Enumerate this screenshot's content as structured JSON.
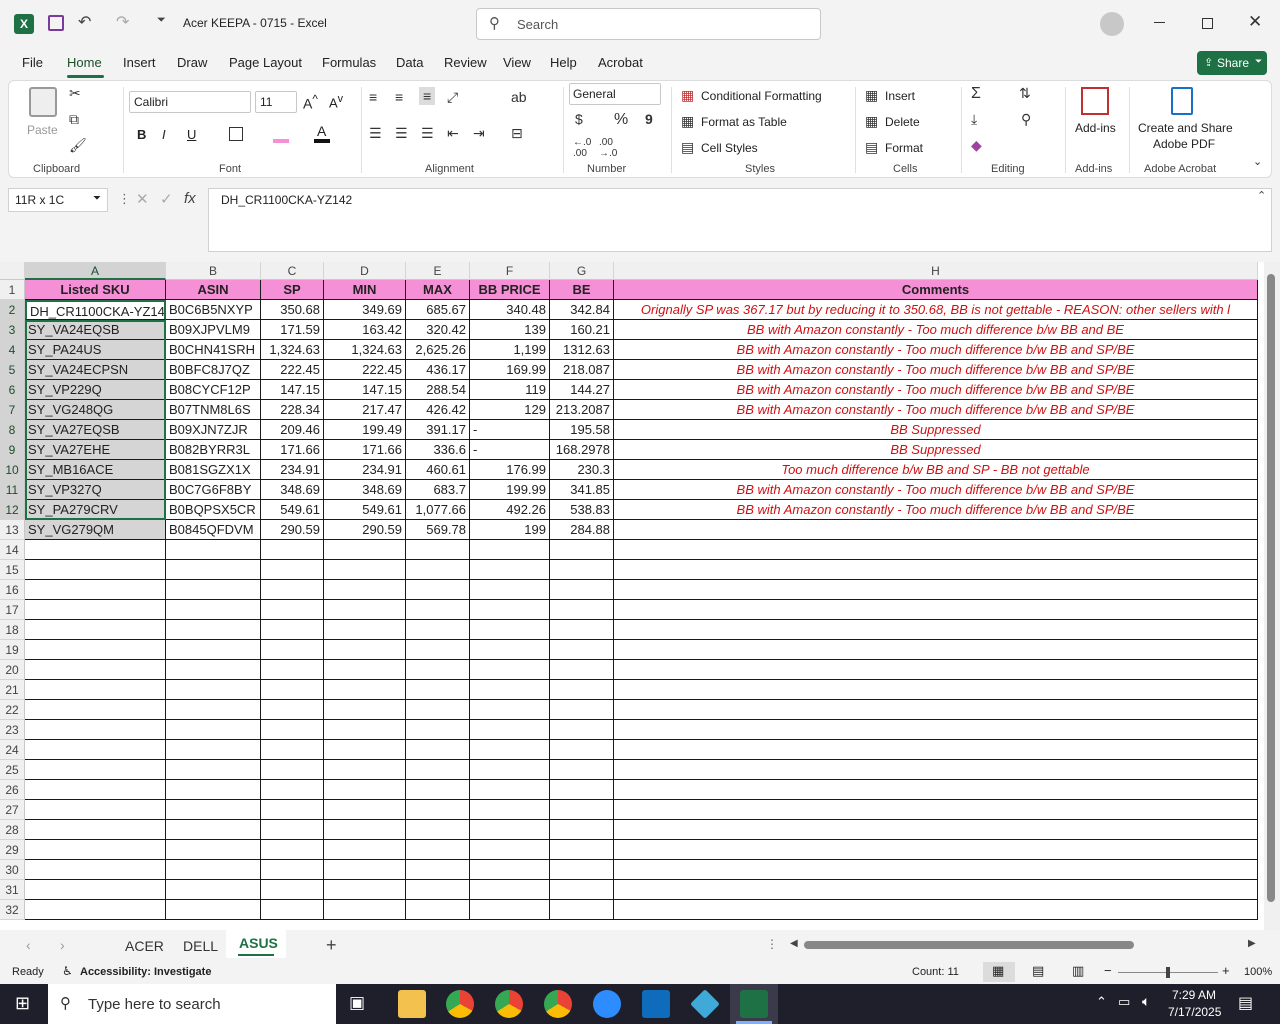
{
  "titlebar": {
    "doc_title": "Acer KEEPA - 0715  -  Excel",
    "search_placeholder": "Search"
  },
  "menu": [
    "File",
    "Home",
    "Insert",
    "Draw",
    "Page Layout",
    "Formulas",
    "Data",
    "Review",
    "View",
    "Help",
    "Acrobat"
  ],
  "share_label": "Share",
  "ribbon": {
    "clipboard": {
      "paste": "Paste",
      "label": "Clipboard"
    },
    "font": {
      "name": "Calibri",
      "size": "11",
      "label": "Font"
    },
    "alignment": {
      "label": "Alignment"
    },
    "number": {
      "format": "General",
      "label": "Number"
    },
    "styles": {
      "conditional": "Conditional Formatting",
      "format_table": "Format as Table",
      "cell_styles": "Cell Styles",
      "label": "Styles"
    },
    "cells": {
      "insert": "Insert",
      "delete": "Delete",
      "format": "Format",
      "label": "Cells"
    },
    "editing": {
      "label": "Editing"
    },
    "addins": {
      "btn": "Add-ins",
      "label": "Add-ins"
    },
    "acrobat": {
      "btn1": "Create and Share",
      "btn2": "Adobe PDF",
      "label": "Adobe Acrobat"
    }
  },
  "formula_bar": {
    "name_box": "11R x 1C",
    "content": "DH_CR1100CKA-YZ142"
  },
  "columns": [
    "A",
    "B",
    "C",
    "D",
    "E",
    "F",
    "G",
    "H"
  ],
  "header_row": [
    "Listed SKU",
    "ASIN",
    "SP",
    "MIN",
    "MAX",
    "BB PRICE",
    "BE",
    "Comments"
  ],
  "rows": [
    [
      "DH_CR1100CKA-YZ142",
      "B0C6B5NXYP",
      "350.68",
      "349.69",
      "685.67",
      "340.48",
      "342.84",
      "Orignally SP was 367.17 but by reducing it to 350.68, BB is not gettable - REASON: other sellers with l"
    ],
    [
      "SY_VA24EQSB",
      "B09XJPVLM9",
      "171.59",
      "163.42",
      "320.42",
      "139",
      "160.21",
      "BB with Amazon constantly - Too much difference b/w BB and BE"
    ],
    [
      "SY_PA24US",
      "B0CHN41SRH",
      "1,324.63",
      "1,324.63",
      "2,625.26",
      "1,199",
      "1312.63",
      "BB with Amazon constantly - Too much difference b/w BB and SP/BE"
    ],
    [
      "SY_VA24ECPSN",
      "B0BFC8J7QZ",
      "222.45",
      "222.45",
      "436.17",
      "169.99",
      "218.087",
      "BB with Amazon constantly - Too much difference b/w BB and SP/BE"
    ],
    [
      "SY_VP229Q",
      "B08CYCF12P",
      "147.15",
      "147.15",
      "288.54",
      "119",
      "144.27",
      "BB with Amazon constantly - Too much difference b/w BB and SP/BE"
    ],
    [
      "SY_VG248QG",
      "B07TNM8L6S",
      "228.34",
      "217.47",
      "426.42",
      "129",
      "213.2087",
      "BB with Amazon constantly - Too much difference b/w BB and SP/BE"
    ],
    [
      "SY_VA27EQSB",
      "B09XJN7ZJR",
      "209.46",
      "199.49",
      "391.17",
      "-",
      "195.58",
      "BB Suppressed"
    ],
    [
      "SY_VA27EHE",
      "B082BYRR3L",
      "171.66",
      "171.66",
      "336.6",
      "-",
      "168.2978",
      "BB Suppressed"
    ],
    [
      "SY_MB16ACE",
      "B081SGZX1X",
      "234.91",
      "234.91",
      "460.61",
      "176.99",
      "230.3",
      "Too much difference b/w BB and SP - BB not gettable"
    ],
    [
      "SY_VP327Q",
      "B0C7G6F8BY",
      "348.69",
      "348.69",
      "683.7",
      "199.99",
      "341.85",
      "BB with Amazon constantly - Too much difference b/w BB and SP/BE"
    ],
    [
      "SY_PA279CRV",
      "B0BQPSX5CR",
      "549.61",
      "549.61",
      "1,077.66",
      "492.26",
      "538.83",
      "BB with Amazon constantly - Too much difference b/w BB and SP/BE"
    ],
    [
      "SY_VG279QM",
      "B0845QFDVM",
      "290.59",
      "290.59",
      "569.78",
      "199",
      "284.88",
      ""
    ]
  ],
  "row_numbers": [
    "1",
    "2",
    "3",
    "4",
    "5",
    "6",
    "7",
    "8",
    "9",
    "10",
    "11",
    "12",
    "13",
    "14",
    "15",
    "16",
    "17",
    "18",
    "19",
    "20",
    "21",
    "22",
    "23",
    "24",
    "25",
    "26",
    "27",
    "28",
    "29",
    "30",
    "31",
    "32"
  ],
  "sheets": [
    "ACER",
    "DELL",
    "ASUS"
  ],
  "active_sheet": "ASUS",
  "status": {
    "ready": "Ready",
    "accessibility": "Accessibility: Investigate",
    "count": "Count: 11",
    "zoom": "100%"
  },
  "taskbar": {
    "search_placeholder": "Type here to search",
    "time": "7:29 AM",
    "date": "7/17/2025"
  },
  "colors": {
    "header_pink": "#f58fd6",
    "comment_red": "#d01010",
    "excel_green": "#1e7145"
  }
}
